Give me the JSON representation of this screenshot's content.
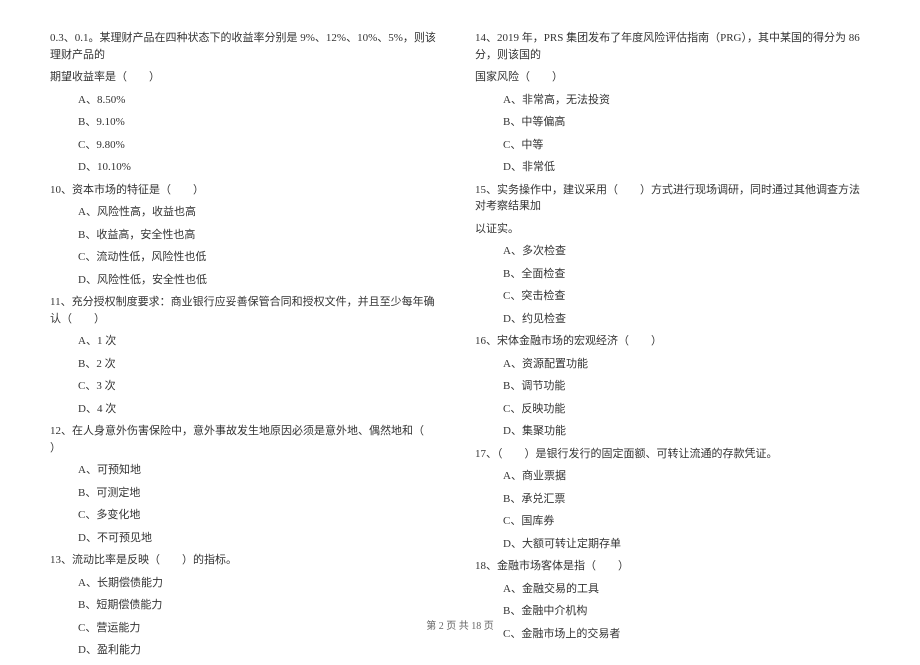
{
  "col1": {
    "q9_cont_line1": "0.3、0.1。某理财产品在四种状态下的收益率分别是 9%、12%、10%、5%，则该理财产品的",
    "q9_cont_line2": "期望收益率是（　　）",
    "q9": {
      "A": "A、8.50%",
      "B": "B、9.10%",
      "C": "C、9.80%",
      "D": "D、10.10%"
    },
    "q10": {
      "stem": "10、资本市场的特征是（　　）",
      "A": "A、风险性高，收益也高",
      "B": "B、收益高，安全性也高",
      "C": "C、流动性低，风险性也低",
      "D": "D、风险性低，安全性也低"
    },
    "q11": {
      "stem": "11、充分授权制度要求：商业银行应妥善保管合同和授权文件，并且至少每年确认（　　）",
      "A": "A、1 次",
      "B": "B、2 次",
      "C": "C、3 次",
      "D": "D、4 次"
    },
    "q12": {
      "stem": "12、在人身意外伤害保险中，意外事故发生地原因必须是意外地、偶然地和（　　）",
      "A": "A、可预知地",
      "B": "B、可测定地",
      "C": "C、多变化地",
      "D": "D、不可预见地"
    },
    "q13": {
      "stem": "13、流动比率是反映（　　）的指标。",
      "A": "A、长期偿债能力",
      "B": "B、短期偿债能力",
      "C": "C、营运能力",
      "D": "D、盈利能力"
    }
  },
  "col2": {
    "q14": {
      "line1": "14、2019 年，PRS 集团发布了年度风险评估指南（PRG），其中某国的得分为 86 分，则该国的",
      "line2": "国家风险（　　）",
      "A": "A、非常高，无法投资",
      "B": "B、中等偏高",
      "C": "C、中等",
      "D": "D、非常低"
    },
    "q15": {
      "line1": "15、实务操作中，建议采用（　　）方式进行现场调研，同时通过其他调查方法对考察结果加",
      "line2": "以证实。",
      "A": "A、多次检查",
      "B": "B、全面检查",
      "C": "C、突击检查",
      "D": "D、约见检查"
    },
    "q16": {
      "stem": "16、宋体金融市场的宏观经济（　　）",
      "A": "A、资源配置功能",
      "B": "B、调节功能",
      "C": "C、反映功能",
      "D": "D、集聚功能"
    },
    "q17": {
      "stem": "17、（　　）是银行发行的固定面额、可转让流通的存款凭证。",
      "A": "A、商业票据",
      "B": "B、承兑汇票",
      "C": "C、国库券",
      "D": "D、大额可转让定期存单"
    },
    "q18": {
      "stem": "18、金融市场客体是指（　　）",
      "A": "A、金融交易的工具",
      "B": "B、金融中介机构",
      "C": "C、金融市场上的交易者"
    }
  },
  "footer": "第 2 页 共 18 页"
}
